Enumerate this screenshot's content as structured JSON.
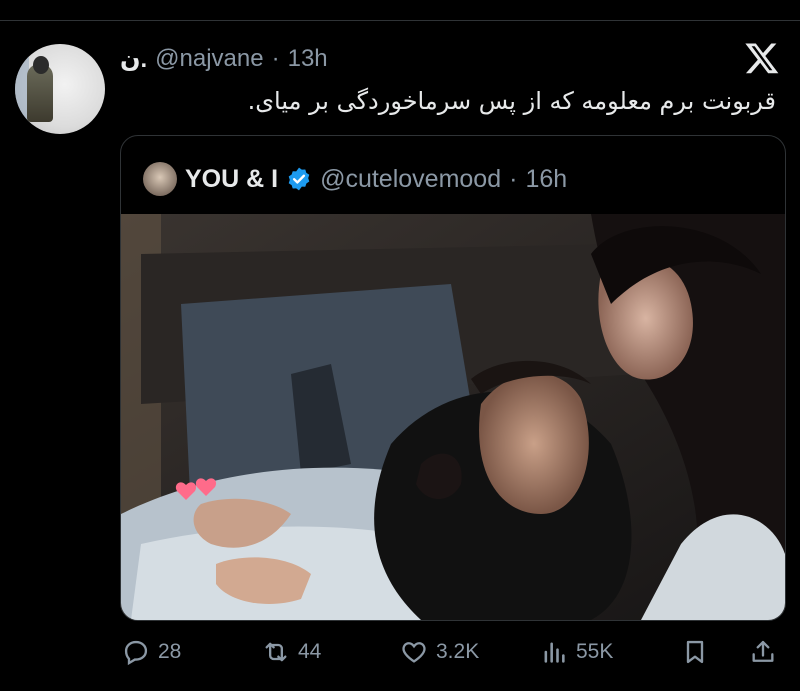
{
  "tweet": {
    "display_name": "ن.",
    "handle": "@najvane",
    "separator": "·",
    "time": "13h",
    "text": "قربونت برم معلومه که از پس سرماخوردگی بر میای."
  },
  "quoted": {
    "display_name": "YOU & I",
    "handle": "@cutelovemood",
    "separator": "·",
    "time": "16h",
    "verified": true,
    "media_alt": "Photo of a couple sleeping, with two pink hearts sticker"
  },
  "actions": {
    "replies": "28",
    "reposts": "44",
    "likes": "3.2K",
    "views": "55K"
  },
  "icons": [
    "x-logo-icon",
    "verified-badge-icon",
    "reply-icon",
    "repost-icon",
    "like-icon",
    "views-icon",
    "bookmark-icon",
    "share-icon"
  ],
  "colors": {
    "background": "#000000",
    "text": "#e7e9ea",
    "secondary": "#8b98a5",
    "verified": "#1d9bf0",
    "heart": "#ff6b8a"
  }
}
